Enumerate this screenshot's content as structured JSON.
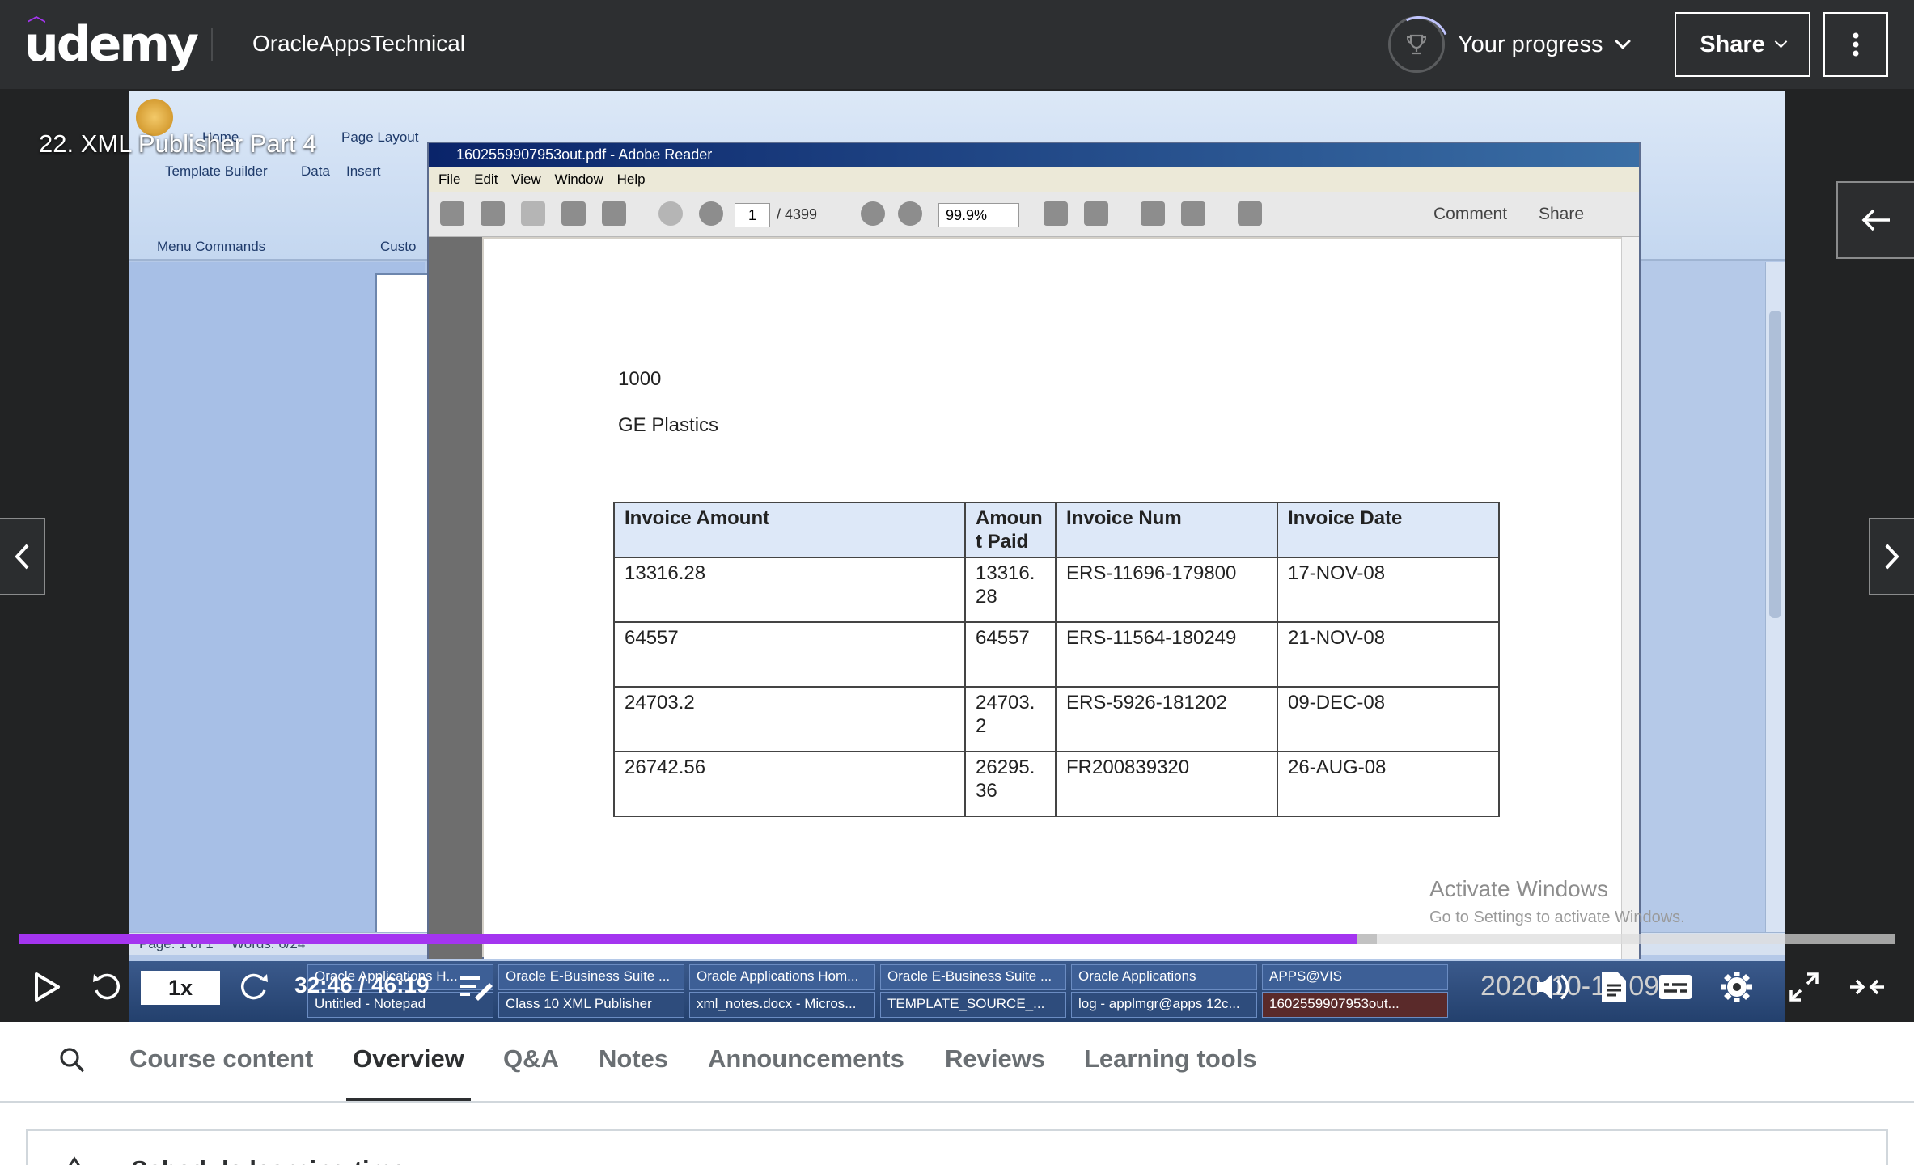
{
  "header": {
    "logo": "udemy",
    "course_title": "OracleAppsTechnical",
    "progress_label": "Your progress",
    "share_label": "Share"
  },
  "video": {
    "lecture_title": "22. XML Publisher Part 4",
    "ribbon": {
      "template_builder": "Template Builder",
      "data": "Data",
      "insert": "Insert",
      "menu_commands": "Menu Commands",
      "page_layout": "Page Layout",
      "home": "Home",
      "custom": "Custo"
    },
    "word_status": {
      "page": "Page: 1 of 1",
      "words": "Words: 6/24"
    },
    "reader": {
      "title": "1602559907953out.pdf - Adobe Reader",
      "menu": [
        "File",
        "Edit",
        "View",
        "Window",
        "Help"
      ],
      "page_current": "1",
      "page_total": "/ 4399",
      "zoom": "99.9%",
      "comment": "Comment",
      "share": "Share"
    },
    "pdf": {
      "line1": "1000",
      "line2": "GE Plastics",
      "headers": [
        "Invoice Amount",
        "Amoun t Paid",
        "Invoice Num",
        "Invoice Date"
      ],
      "rows": [
        [
          "13316.28",
          "13316. 28",
          "ERS-11696-179800",
          "17-NOV-08"
        ],
        [
          "64557",
          "64557",
          "ERS-11564-180249",
          "21-NOV-08"
        ],
        [
          "24703.2",
          "24703. 2",
          "ERS-5926-181202",
          "09-DEC-08"
        ],
        [
          "26742.56",
          "26295. 36",
          "FR200839320",
          "26-AUG-08"
        ]
      ]
    },
    "activate_windows": "Activate Windows",
    "activate_sub": "Go to Settings to activate Windows.",
    "taskbar": {
      "row1": [
        "Oracle Applications H...",
        "Oracle E-Business Suite ...",
        "Oracle Applications Hom...",
        "Oracle E-Business Suite ...",
        "Oracle Applications",
        "APPS@VIS"
      ],
      "row2": [
        "Untitled - Notepad",
        "Class 10 XML Publisher",
        "xml_notes.docx - Micros...",
        "TEMPLATE_SOURCE_...",
        "log - applmgr@apps 12c...",
        "1602559907953out..."
      ]
    },
    "clock": "2020-10-13 09:3",
    "player": {
      "speed": "1x",
      "time": "32:46 / 46:19",
      "progress_played": 0.713,
      "progress_buffered": 0.724
    }
  },
  "tabs": {
    "items": [
      "Course content",
      "Overview",
      "Q&A",
      "Notes",
      "Announcements",
      "Reviews",
      "Learning tools"
    ],
    "active": "Overview"
  },
  "bottom": {
    "heading": "Schedule learning time"
  }
}
